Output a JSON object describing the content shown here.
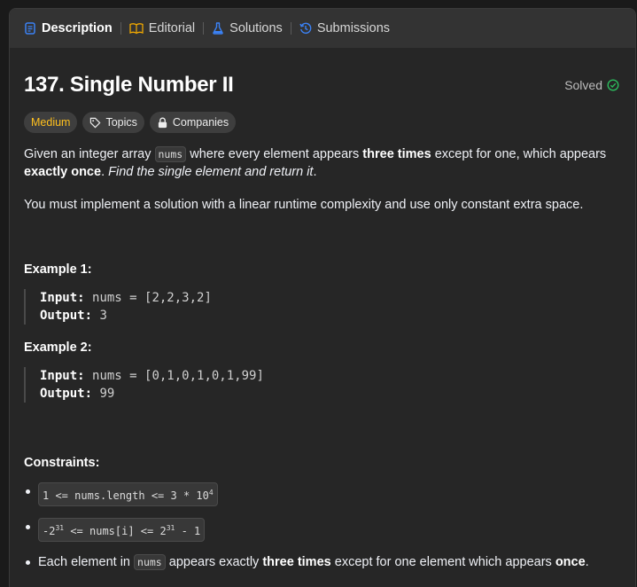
{
  "tabs": [
    {
      "label": "Description",
      "icon": "description-icon",
      "active": true
    },
    {
      "label": "Editorial",
      "icon": "book-icon",
      "active": false
    },
    {
      "label": "Solutions",
      "icon": "flask-icon",
      "active": false
    },
    {
      "label": "Submissions",
      "icon": "history-icon",
      "active": false
    }
  ],
  "problem": {
    "title": "137. Single Number II",
    "status": "Solved",
    "difficulty": "Medium",
    "topics_label": "Topics",
    "companies_label": "Companies"
  },
  "description": {
    "p1_a": "Given an integer array",
    "p1_code": "nums",
    "p1_b": "where every element appears",
    "p1_bold1": "three times",
    "p1_c": "except for one, which appears",
    "p1_bold2": "exactly once",
    "p1_d": ".",
    "p1_italic": "Find the single element and return it",
    "p1_e": ".",
    "p2": "You must implement a solution with a linear runtime complexity and use only constant extra space."
  },
  "examples": [
    {
      "title": "Example 1:",
      "input_label": "Input:",
      "input": "nums = [2,2,3,2]",
      "output_label": "Output:",
      "output": "3"
    },
    {
      "title": "Example 2:",
      "input_label": "Input:",
      "input": "nums = [0,1,0,1,0,1,99]",
      "output_label": "Output:",
      "output": "99"
    }
  ],
  "constraints": {
    "title": "Constraints:",
    "c1_a": "1 <= nums.length <= 3 * 10",
    "c1_sup": "4",
    "c2_a": "-2",
    "c2_sup1": "31",
    "c2_b": "<= nums[i] <= 2",
    "c2_sup2": "31",
    "c2_c": "- 1",
    "c3_a": "Each element in",
    "c3_code": "nums",
    "c3_b": "appears exactly",
    "c3_bold1": "three times",
    "c3_c": "except for one element which appears",
    "c3_bold2": "once",
    "c3_d": "."
  },
  "colors": {
    "accent_blue": "#3b82f6",
    "medium": "#ffc01e",
    "solved_green": "#2cbb5d"
  }
}
